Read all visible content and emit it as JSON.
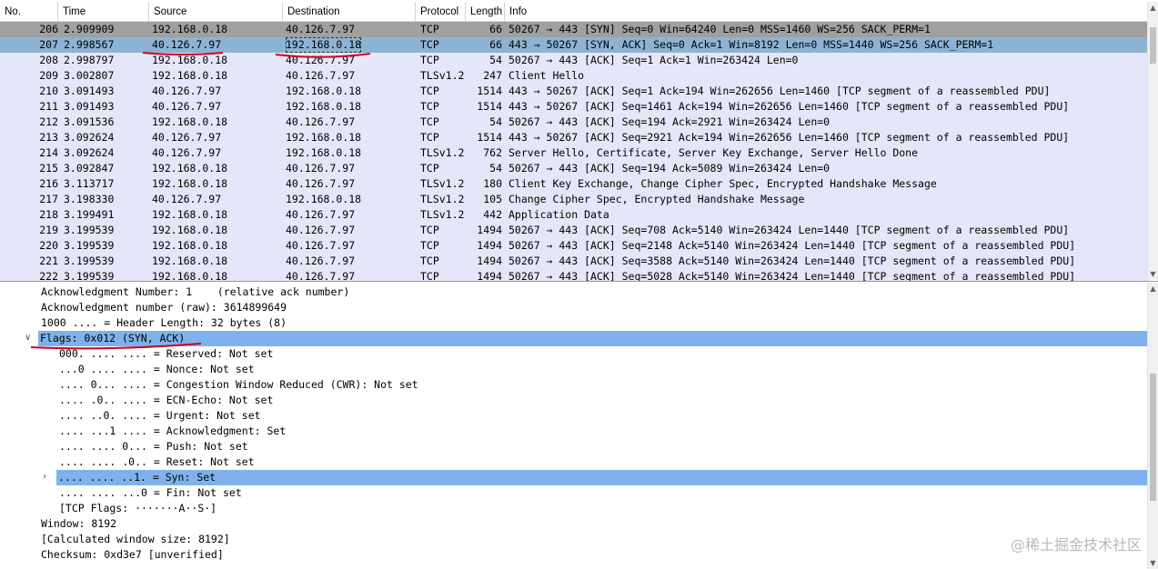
{
  "columns": [
    "No.",
    "Time",
    "Source",
    "Destination",
    "Protocol",
    "Length",
    "Info"
  ],
  "packets": [
    {
      "no": "206",
      "time": "2.909909",
      "src": "192.168.0.18",
      "dst": "40.126.7.97",
      "proto": "TCP",
      "len": "66",
      "info": "50267 → 443 [SYN] Seq=0 Win=64240 Len=0 MSS=1460 WS=256 SACK_PERM=1"
    },
    {
      "no": "207",
      "time": "2.998567",
      "src": "40.126.7.97",
      "dst": "192.168.0.18",
      "proto": "TCP",
      "len": "66",
      "info": "443 → 50267 [SYN, ACK] Seq=0 Ack=1 Win=8192 Len=0 MSS=1440 WS=256 SACK_PERM=1"
    },
    {
      "no": "208",
      "time": "2.998797",
      "src": "192.168.0.18",
      "dst": "40.126.7.97",
      "proto": "TCP",
      "len": "54",
      "info": "50267 → 443 [ACK] Seq=1 Ack=1 Win=263424 Len=0"
    },
    {
      "no": "209",
      "time": "3.002807",
      "src": "192.168.0.18",
      "dst": "40.126.7.97",
      "proto": "TLSv1.2",
      "len": "247",
      "info": "Client Hello"
    },
    {
      "no": "210",
      "time": "3.091493",
      "src": "40.126.7.97",
      "dst": "192.168.0.18",
      "proto": "TCP",
      "len": "1514",
      "info": "443 → 50267 [ACK] Seq=1 Ack=194 Win=262656 Len=1460 [TCP segment of a reassembled PDU]"
    },
    {
      "no": "211",
      "time": "3.091493",
      "src": "40.126.7.97",
      "dst": "192.168.0.18",
      "proto": "TCP",
      "len": "1514",
      "info": "443 → 50267 [ACK] Seq=1461 Ack=194 Win=262656 Len=1460 [TCP segment of a reassembled PDU]"
    },
    {
      "no": "212",
      "time": "3.091536",
      "src": "192.168.0.18",
      "dst": "40.126.7.97",
      "proto": "TCP",
      "len": "54",
      "info": "50267 → 443 [ACK] Seq=194 Ack=2921 Win=263424 Len=0"
    },
    {
      "no": "213",
      "time": "3.092624",
      "src": "40.126.7.97",
      "dst": "192.168.0.18",
      "proto": "TCP",
      "len": "1514",
      "info": "443 → 50267 [ACK] Seq=2921 Ack=194 Win=262656 Len=1460 [TCP segment of a reassembled PDU]"
    },
    {
      "no": "214",
      "time": "3.092624",
      "src": "40.126.7.97",
      "dst": "192.168.0.18",
      "proto": "TLSv1.2",
      "len": "762",
      "info": "Server Hello, Certificate, Server Key Exchange, Server Hello Done"
    },
    {
      "no": "215",
      "time": "3.092847",
      "src": "192.168.0.18",
      "dst": "40.126.7.97",
      "proto": "TCP",
      "len": "54",
      "info": "50267 → 443 [ACK] Seq=194 Ack=5089 Win=263424 Len=0"
    },
    {
      "no": "216",
      "time": "3.113717",
      "src": "192.168.0.18",
      "dst": "40.126.7.97",
      "proto": "TLSv1.2",
      "len": "180",
      "info": "Client Key Exchange, Change Cipher Spec, Encrypted Handshake Message"
    },
    {
      "no": "217",
      "time": "3.198330",
      "src": "40.126.7.97",
      "dst": "192.168.0.18",
      "proto": "TLSv1.2",
      "len": "105",
      "info": "Change Cipher Spec, Encrypted Handshake Message"
    },
    {
      "no": "218",
      "time": "3.199491",
      "src": "192.168.0.18",
      "dst": "40.126.7.97",
      "proto": "TLSv1.2",
      "len": "442",
      "info": "Application Data"
    },
    {
      "no": "219",
      "time": "3.199539",
      "src": "192.168.0.18",
      "dst": "40.126.7.97",
      "proto": "TCP",
      "len": "1494",
      "info": "50267 → 443 [ACK] Seq=708 Ack=5140 Win=263424 Len=1440 [TCP segment of a reassembled PDU]"
    },
    {
      "no": "220",
      "time": "3.199539",
      "src": "192.168.0.18",
      "dst": "40.126.7.97",
      "proto": "TCP",
      "len": "1494",
      "info": "50267 → 443 [ACK] Seq=2148 Ack=5140 Win=263424 Len=1440 [TCP segment of a reassembled PDU]"
    },
    {
      "no": "221",
      "time": "3.199539",
      "src": "192.168.0.18",
      "dst": "40.126.7.97",
      "proto": "TCP",
      "len": "1494",
      "info": "50267 → 443 [ACK] Seq=3588 Ack=5140 Win=263424 Len=1440 [TCP segment of a reassembled PDU]"
    },
    {
      "no": "222",
      "time": "3.199539",
      "src": "192.168.0.18",
      "dst": "40.126.7.97",
      "proto": "TCP",
      "len": "1494",
      "info": "50267 → 443 [ACK] Seq=5028 Ack=5140 Win=263424 Len=1440 [TCP segment of a reassembled PDU]"
    }
  ],
  "selected_packet": "207",
  "details": [
    {
      "text": "Acknowledgment Number: 1    (relative ack number)"
    },
    {
      "text": "Acknowledgment number (raw): 3614899649"
    },
    {
      "text": "1000 .... = Header Length: 32 bytes (8)"
    },
    {
      "text": "Flags: 0x012 (SYN, ACK)",
      "expanded": true,
      "highlight": true
    },
    {
      "text": "000. .... .... = Reserved: Not set"
    },
    {
      "text": "...0 .... .... = Nonce: Not set"
    },
    {
      "text": ".... 0... .... = Congestion Window Reduced (CWR): Not set"
    },
    {
      "text": ".... .0.. .... = ECN-Echo: Not set"
    },
    {
      "text": ".... ..0. .... = Urgent: Not set"
    },
    {
      "text": ".... ...1 .... = Acknowledgment: Set"
    },
    {
      "text": ".... .... 0... = Push: Not set"
    },
    {
      "text": ".... .... .0.. = Reset: Not set"
    },
    {
      "text": ".... .... ..1. = Syn: Set",
      "collapsed": true,
      "highlight": true
    },
    {
      "text": ".... .... ...0 = Fin: Not set"
    },
    {
      "text": "[TCP Flags: ·······A··S·]"
    },
    {
      "text": "Window: 8192"
    },
    {
      "text": "[Calculated window size: 8192]"
    },
    {
      "text": "Checksum: 0xd3e7 [unverified]"
    }
  ],
  "watermark": "@稀土掘金技术社区",
  "colors": {
    "tcp_row": "#e6e6fa",
    "syn_row": "#a0a0a0",
    "selected_row": "#8cb4d2",
    "detail_highlight": "#7fb2ec",
    "annotation": "#d0021b"
  }
}
